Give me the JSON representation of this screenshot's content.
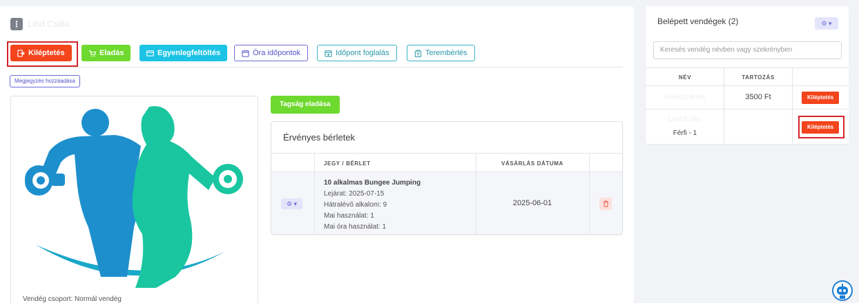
{
  "header": {
    "guest_name": "Lind Csilla"
  },
  "toolbar": {
    "checkout_label": "Kiléptetés",
    "sale_label": "Eladás",
    "topup_label": "Egyenlegfeltöltés",
    "class_times_label": "Óra időpontok",
    "booking_label": "Időpont foglalás",
    "room_rental_label": "Terembérlés"
  },
  "note_button_label": "Megjegyzés hozzáadása",
  "guest": {
    "group_label": "Vendég csoport: Normál vendég"
  },
  "membership_sale_label": "Tagság eladása",
  "passes": {
    "title": "Érvényes bérletek",
    "columns": [
      "JEGY / BÉRLET",
      "VÁSÁRLÁS DÁTUMA"
    ],
    "rows": [
      {
        "name": "10 alkalmas Bungee Jumping",
        "expiry": "Lejárat: 2025-07-15",
        "remaining": "Hátralévő alkalom: 9",
        "today_usage": "Mai használat: 1",
        "today_class_usage": "Mai óra használat: 1",
        "purchase_date": "2025-06-01"
      }
    ]
  },
  "checked_in": {
    "title": "Belépett vendégek (2)",
    "search_placeholder": "Keresés vendég névben vagy szekrényben",
    "columns": [
      "NÉV",
      "TARTOZÁS"
    ],
    "rows": [
      {
        "name": "Kovács Anita",
        "debt": "3500 Ft",
        "locker": "",
        "action": "Kiléptetés"
      },
      {
        "name": "Lind Csilla",
        "debt": "",
        "locker": "Férfi - 1",
        "action": "Kiléptetés"
      }
    ]
  },
  "colors": {
    "danger": "#f4441c",
    "success": "#6ed92e",
    "info": "#1cc3e5",
    "primary": "#6b6bd6",
    "highlight": "#d3242a",
    "figure_blue": "#1e8fcd",
    "figure_teal": "#19c6a0"
  },
  "icons": {
    "kebab": "kebab-menu-icon",
    "checkout": "logout-icon",
    "sale": "cart-icon",
    "topup": "credit-card-icon",
    "classes": "calendar-icon",
    "booking": "calendar-plus-icon",
    "rental": "clipboard-icon",
    "gear": "gear-icon",
    "trash": "trash-icon",
    "assistant": "robot-icon"
  }
}
